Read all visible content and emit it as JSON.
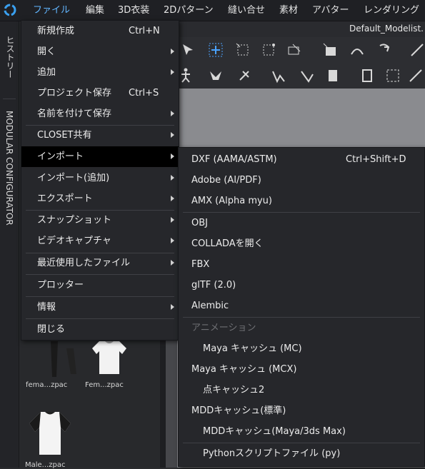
{
  "menubar": {
    "items": [
      "ファイル",
      "編集",
      "3D衣装",
      "2Dパターン",
      "縫い合せ",
      "素材",
      "アバター",
      "レンダリング"
    ]
  },
  "side_tabs": {
    "history": "ヒストリー",
    "modular": "MODULAR CONFIGURATOR"
  },
  "document_title": "Default_Modelist.",
  "library": {
    "items": [
      {
        "label": "fema...zpac"
      },
      {
        "label": "Fem...zpac"
      },
      {
        "label": "Male...zpac"
      }
    ]
  },
  "file_menu": {
    "items": [
      {
        "label": "新規作成",
        "shortcut": "Ctrl+N"
      },
      {
        "label": "開く",
        "submenu": true
      },
      {
        "label": "追加",
        "submenu": true
      },
      {
        "label": "プロジェクト保存",
        "shortcut": "Ctrl+S"
      },
      {
        "label": "名前を付けて保存",
        "submenu": true
      },
      {
        "label": "CLOSET共有",
        "submenu": true
      },
      {
        "label": "インポート",
        "submenu": true,
        "highlighted": true
      },
      {
        "label": "インポート(追加)",
        "submenu": true
      },
      {
        "label": "エクスポート",
        "submenu": true
      },
      {
        "label": "スナップショット",
        "submenu": true
      },
      {
        "label": "ビデオキャプチャ",
        "submenu": true
      },
      {
        "label": "最近使用したファイル",
        "submenu": true
      },
      {
        "label": "プロッター"
      },
      {
        "label": "情報",
        "submenu": true
      },
      {
        "label": "閉じる"
      }
    ]
  },
  "import_menu": {
    "items": [
      {
        "label": "DXF (AAMA/ASTM)",
        "shortcut": "Ctrl+Shift+D"
      },
      {
        "label": "Adobe (AI/PDF)"
      },
      {
        "label": "AMX (Alpha myu)"
      },
      {
        "label": "OBJ"
      },
      {
        "label": "COLLADAを開く"
      },
      {
        "label": "FBX"
      },
      {
        "label": "glTF (2.0)"
      },
      {
        "label": "Alembic"
      },
      {
        "label": "アニメーション",
        "disabled": true
      },
      {
        "label": "Maya キャッシュ (MC)",
        "indent": true
      },
      {
        "label": "Maya キャッシュ (MCX)"
      },
      {
        "label": "点キャッシュ2",
        "indent": true
      },
      {
        "label": "MDDキャッシュ(標準)"
      },
      {
        "label": "MDDキャッシュ(Maya/3ds Max)",
        "indent": true
      },
      {
        "label": "Pythonスクリプトファイル (py)",
        "indent": true
      }
    ]
  },
  "colors": {
    "menubar_active": "#62b6ff",
    "menu_bg": "#26272b",
    "highlight": "#000000",
    "tool_accent": "#4aa3ff"
  },
  "toolbar_icons": [
    "select-icon",
    "transform-icon",
    "edit-point-icon",
    "edit-curve-icon",
    "add-point-icon",
    "segment-icon",
    "arrange-icon",
    "fold-icon",
    "avatar-pose-icon",
    "pin-icon",
    "tack-icon",
    "sewing-icon",
    "free-sewing-icon",
    "sewing-pair-icon",
    "garment-icon",
    "fabric-icon",
    "texture-icon"
  ]
}
